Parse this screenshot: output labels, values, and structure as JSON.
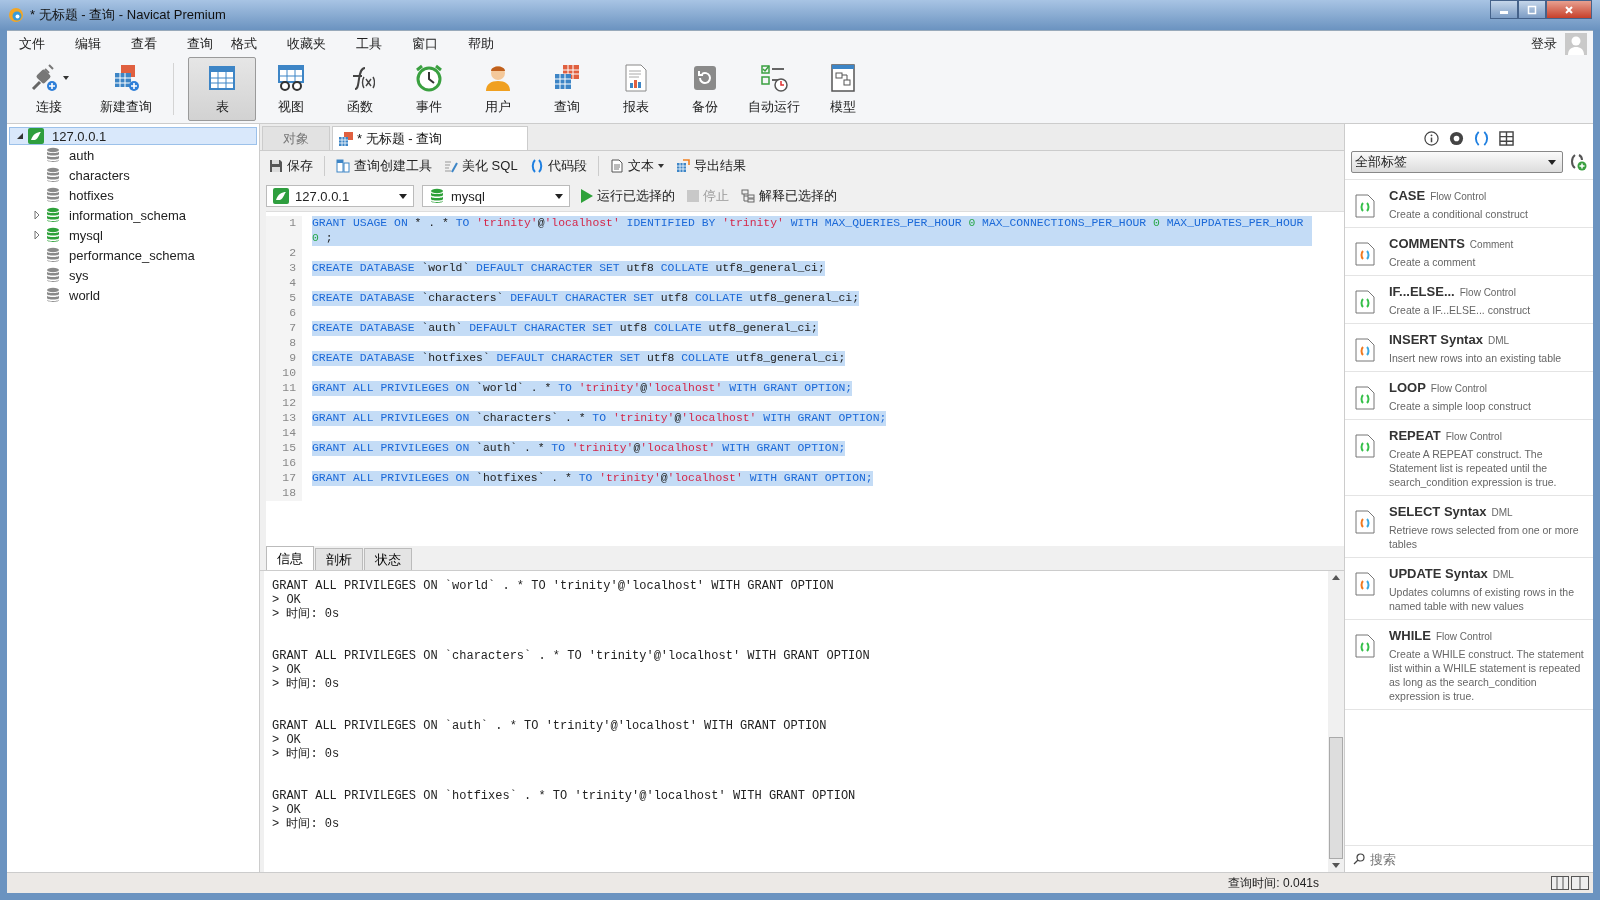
{
  "window": {
    "title": "* 无标题 - 查询 - Navicat Premium"
  },
  "menu": [
    "文件",
    "编辑",
    "查看",
    "查询",
    "格式",
    "收藏夹",
    "工具",
    "窗口",
    "帮助"
  ],
  "login": "登录",
  "toolbar": [
    {
      "label": "连接",
      "kind": "connect",
      "selected": false,
      "dropdown": true
    },
    {
      "label": "新建查询",
      "kind": "newquery",
      "selected": false
    },
    {
      "label": "表",
      "kind": "table",
      "selected": true
    },
    {
      "label": "视图",
      "kind": "view",
      "selected": false
    },
    {
      "label": "函数",
      "kind": "function",
      "selected": false
    },
    {
      "label": "事件",
      "kind": "event",
      "selected": false
    },
    {
      "label": "用户",
      "kind": "user",
      "selected": false
    },
    {
      "label": "查询",
      "kind": "query",
      "selected": false
    },
    {
      "label": "报表",
      "kind": "report",
      "selected": false
    },
    {
      "label": "备份",
      "kind": "backup",
      "selected": false
    },
    {
      "label": "自动运行",
      "kind": "autorun",
      "selected": false
    },
    {
      "label": "模型",
      "kind": "model",
      "selected": false
    }
  ],
  "tree": [
    {
      "label": "127.0.0.1",
      "selected": true,
      "expanded": true,
      "children": [
        {
          "label": "auth",
          "open": false
        },
        {
          "label": "characters",
          "open": false
        },
        {
          "label": "hotfixes",
          "open": false
        },
        {
          "label": "information_schema",
          "open": true,
          "expanded": false
        },
        {
          "label": "mysql",
          "open": true,
          "expanded": false
        },
        {
          "label": "performance_schema",
          "open": false
        },
        {
          "label": "sys",
          "open": false
        },
        {
          "label": "world",
          "open": false
        }
      ]
    }
  ],
  "doc_tabs": [
    {
      "label": "对象",
      "selected": false,
      "kind": "objects"
    },
    {
      "label": "* 无标题 - 查询",
      "selected": true,
      "kind": "query"
    }
  ],
  "query_toolbar": [
    {
      "label": "保存",
      "kind": "save"
    },
    {
      "label": "查询创建工具",
      "kind": "builder"
    },
    {
      "label": "美化 SQL",
      "kind": "beautify"
    },
    {
      "label": "代码段",
      "kind": "snippet"
    },
    {
      "label": "文本",
      "kind": "text",
      "dropdown": true
    },
    {
      "label": "导出结果",
      "kind": "export"
    }
  ],
  "connection": "127.0.0.1",
  "database": "mysql",
  "run_actions": [
    {
      "label": "运行已选择的",
      "kind": "run",
      "disabled": false
    },
    {
      "label": "停止",
      "kind": "stop",
      "disabled": true
    },
    {
      "label": "解释已选择的",
      "kind": "explain",
      "disabled": false
    }
  ],
  "editor": {
    "selected": true,
    "lines": [
      {
        "n": "1",
        "code": "GRANT USAGE ON * . * TO 'trinity'@'localhost' IDENTIFIED BY 'trinity' WITH MAX_QUERIES_PER_HOUR 0 MAX_CONNECTIONS_PER_HOUR 0 MAX_UPDATES_PER_HOUR 0 ;"
      },
      {
        "n": "2"
      },
      {
        "n": "3",
        "code": "CREATE DATABASE `world` DEFAULT CHARACTER SET utf8 COLLATE utf8_general_ci;"
      },
      {
        "n": "4"
      },
      {
        "n": "5",
        "code": "CREATE DATABASE `characters` DEFAULT CHARACTER SET utf8 COLLATE utf8_general_ci;"
      },
      {
        "n": "6"
      },
      {
        "n": "7",
        "code": "CREATE DATABASE `auth` DEFAULT CHARACTER SET utf8 COLLATE utf8_general_ci;"
      },
      {
        "n": "8"
      },
      {
        "n": "9",
        "code": "CREATE DATABASE `hotfixes` DEFAULT CHARACTER SET utf8 COLLATE utf8_general_ci;"
      },
      {
        "n": "10"
      },
      {
        "n": "11",
        "code": "GRANT ALL PRIVILEGES ON `world` . * TO 'trinity'@'localhost' WITH GRANT OPTION;"
      },
      {
        "n": "12"
      },
      {
        "n": "13",
        "code": "GRANT ALL PRIVILEGES ON `characters` . * TO 'trinity'@'localhost' WITH GRANT OPTION;"
      },
      {
        "n": "14"
      },
      {
        "n": "15",
        "code": "GRANT ALL PRIVILEGES ON `auth` . * TO 'trinity'@'localhost' WITH GRANT OPTION;"
      },
      {
        "n": "16"
      },
      {
        "n": "17",
        "code": "GRANT ALL PRIVILEGES ON `hotfixes` . * TO 'trinity'@'localhost' WITH GRANT OPTION;"
      },
      {
        "n": "18"
      }
    ]
  },
  "result_tabs": [
    {
      "label": "信息",
      "selected": true
    },
    {
      "label": "剖析",
      "selected": false
    },
    {
      "label": "状态",
      "selected": false
    }
  ],
  "messages": [
    [
      "GRANT ALL PRIVILEGES ON `world` . * TO 'trinity'@'localhost' WITH GRANT OPTION",
      "> OK",
      "> 时间: 0s"
    ],
    [
      "GRANT ALL PRIVILEGES ON `characters` . * TO 'trinity'@'localhost' WITH GRANT OPTION",
      "> OK",
      "> 时间: 0s"
    ],
    [
      "GRANT ALL PRIVILEGES ON `auth` . * TO 'trinity'@'localhost' WITH GRANT OPTION",
      "> OK",
      "> 时间: 0s"
    ],
    [
      "GRANT ALL PRIVILEGES ON `hotfixes` . * TO 'trinity'@'localhost' WITH GRANT OPTION",
      "> OK",
      "> 时间: 0s"
    ]
  ],
  "snippet_panel": {
    "filter": "全部标签",
    "search_placeholder": "搜索",
    "items": [
      {
        "title": "CASE",
        "category": "Flow Control",
        "desc": "Create a conditional construct",
        "kind": "builtin"
      },
      {
        "title": "COMMENTS",
        "category": "Comment",
        "desc": "Create a comment",
        "kind": "syntax"
      },
      {
        "title": "IF...ELSE...",
        "category": "Flow Control",
        "desc": "Create a IF...ELSE... construct",
        "kind": "builtin"
      },
      {
        "title": "INSERT Syntax",
        "category": "DML",
        "desc": "Insert new rows into an existing table",
        "kind": "syntax"
      },
      {
        "title": "LOOP",
        "category": "Flow Control",
        "desc": "Create a simple loop construct",
        "kind": "builtin"
      },
      {
        "title": "REPEAT",
        "category": "Flow Control",
        "desc": "Create A REPEAT construct. The Statement list is repeated until the search_condition expression is true.",
        "kind": "builtin"
      },
      {
        "title": "SELECT Syntax",
        "category": "DML",
        "desc": "Retrieve rows selected from one or more tables",
        "kind": "syntax"
      },
      {
        "title": "UPDATE Syntax",
        "category": "DML",
        "desc": "Updates columns of existing rows in the named table with new values",
        "kind": "syntax"
      },
      {
        "title": "WHILE",
        "category": "Flow Control",
        "desc": "Create a WHILE construct. The statement list within a WHILE statement is repeated as long as the search_condition expression is true.",
        "kind": "builtin"
      }
    ]
  },
  "status_bar": {
    "query_time": "查询时间: 0.041s"
  }
}
